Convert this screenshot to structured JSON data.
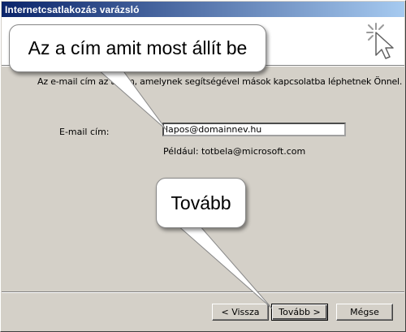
{
  "window": {
    "title": "Internetcsatlakozás varázsló"
  },
  "description": "Az e-mail cím az a cím, amelynek segítségével mások kapcsolatba léphetnek Önnel.",
  "email": {
    "label": "E-mail cím:",
    "value": "lapos@domainnev.hu",
    "example": "Például: totbela@microsoft.com"
  },
  "buttons": {
    "back": "< Vissza",
    "next": "Tovább >",
    "cancel": "Mégse"
  },
  "callouts": {
    "email_hint": "Az a cím amit most állít be",
    "next_hint": "Tovább"
  },
  "icons": {
    "wizard": "sparkle-cursor-icon"
  }
}
